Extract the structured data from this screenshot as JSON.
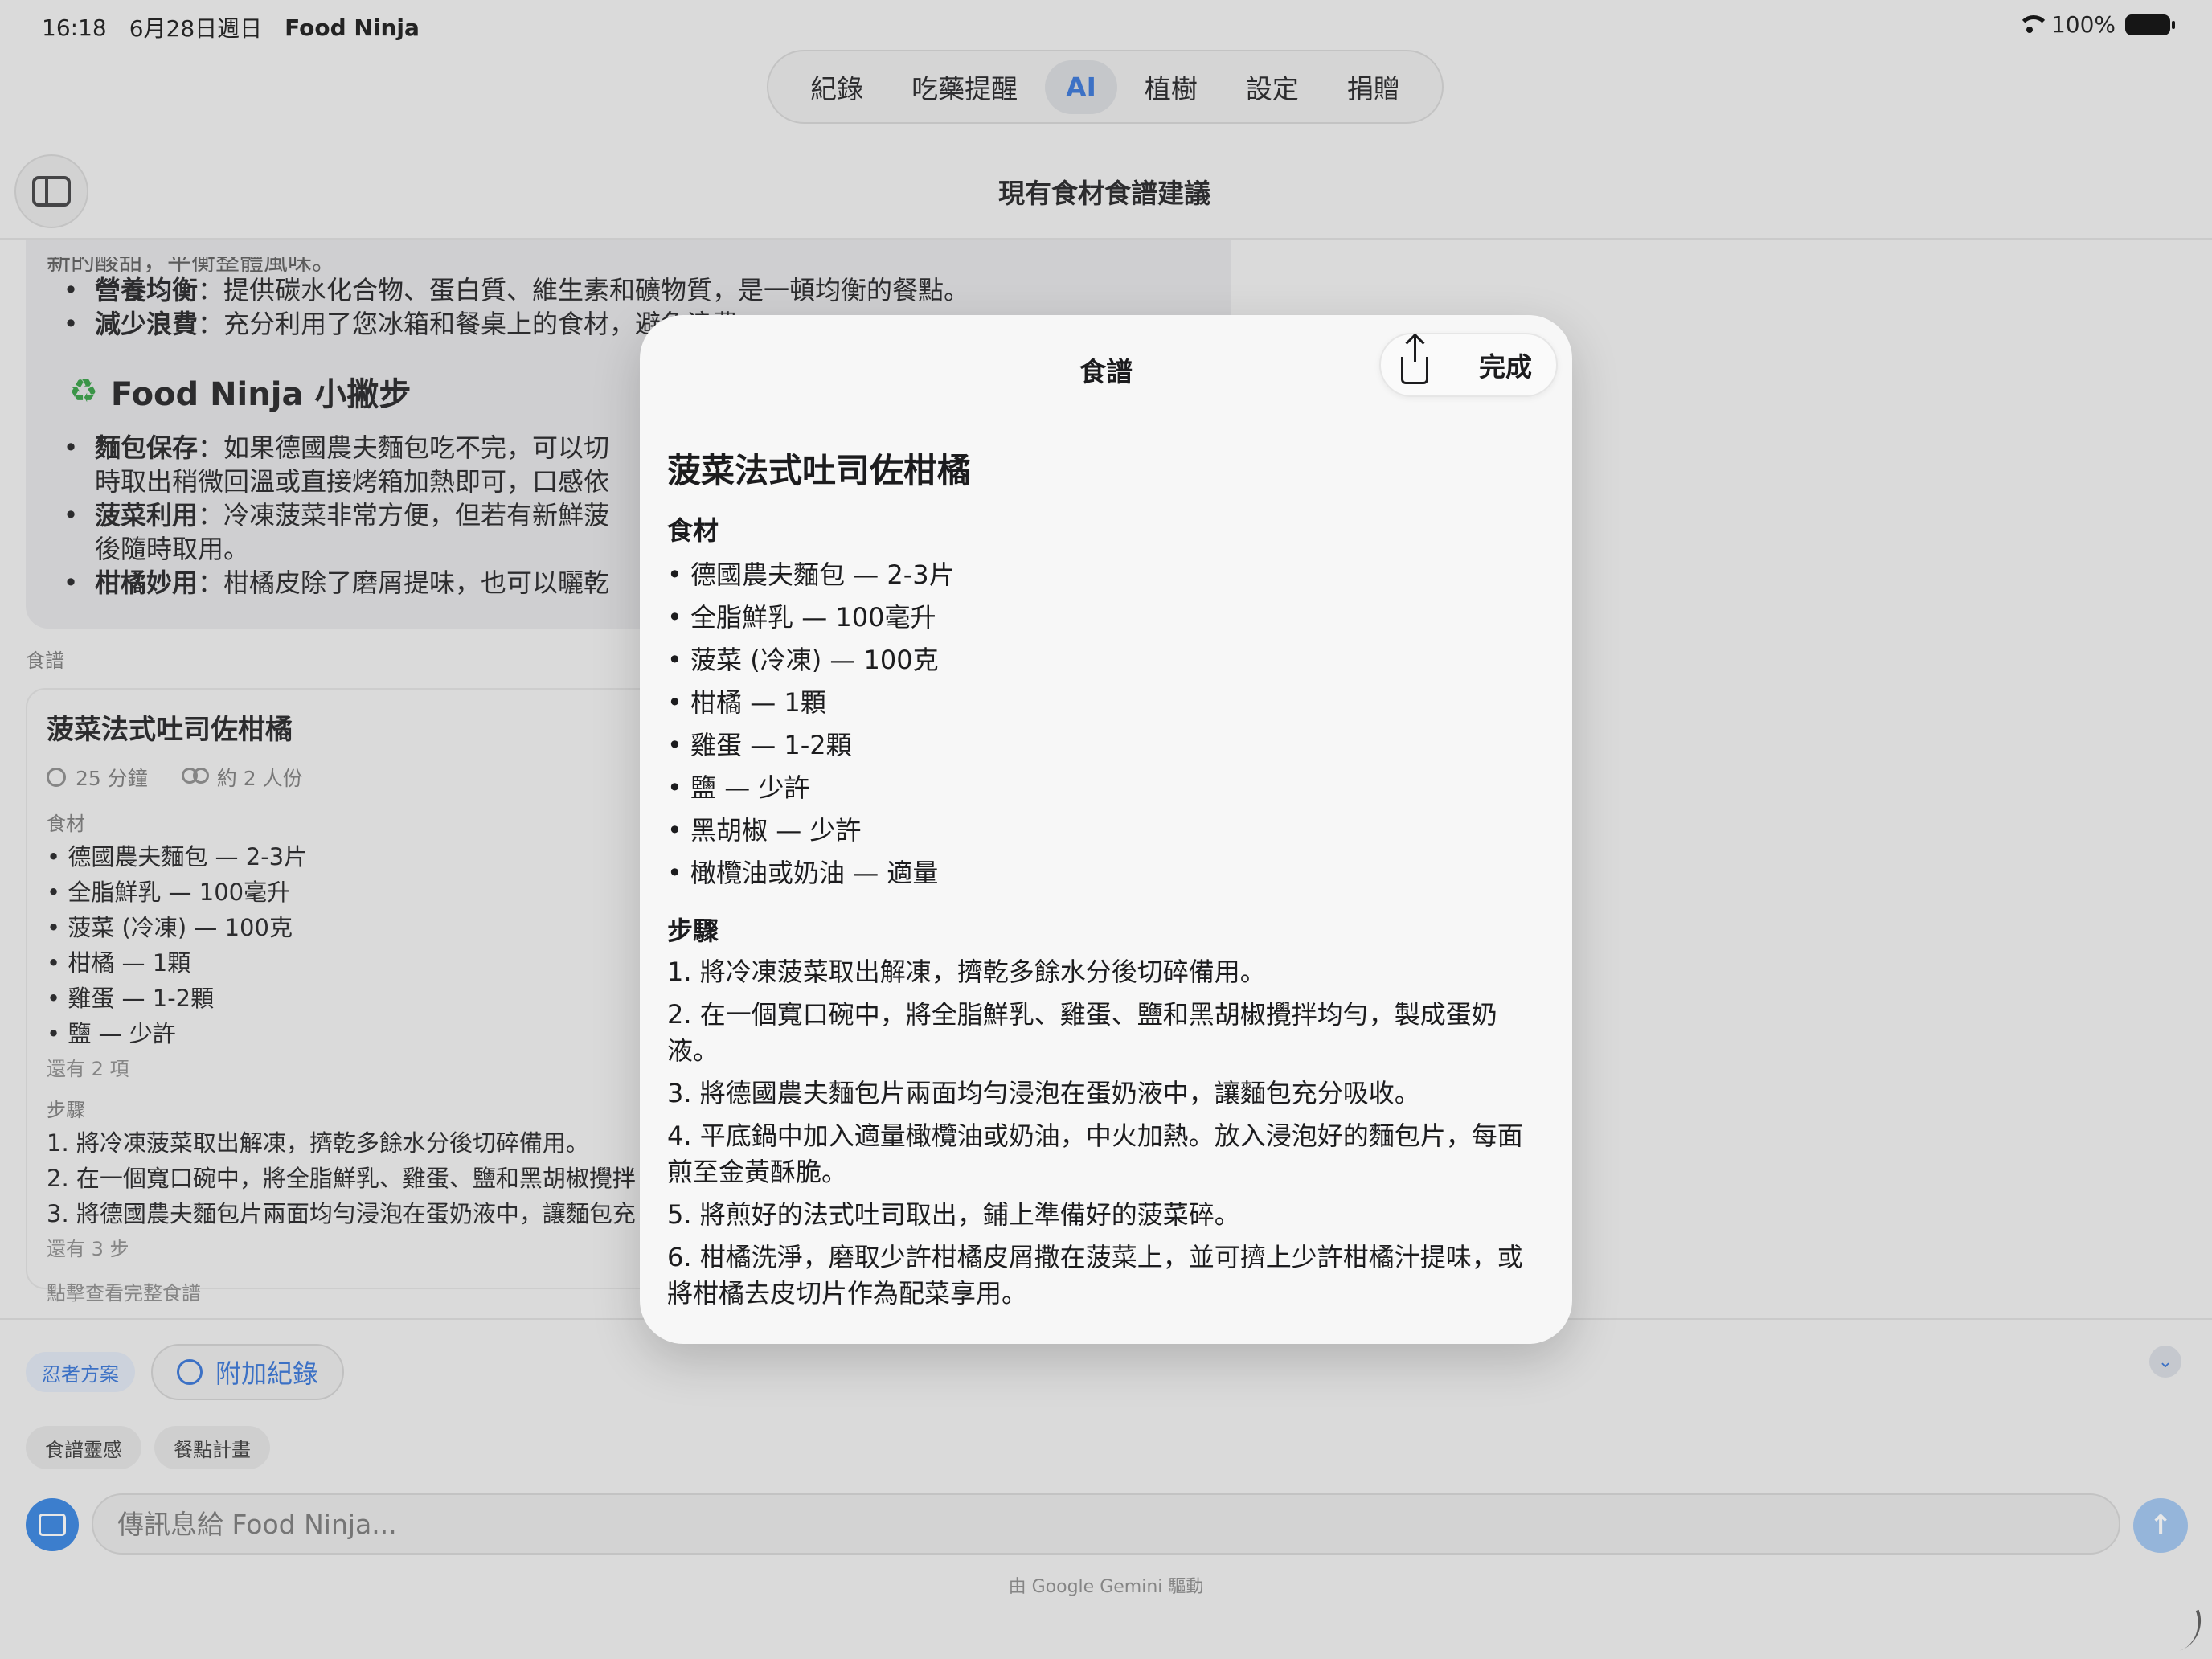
{
  "status_bar": {
    "time": "16:18",
    "date": "6月28日週日",
    "app_name": "Food Ninja",
    "battery": "100%"
  },
  "tabs": [
    {
      "label": "紀錄",
      "active": false
    },
    {
      "label": "吃藥提醒",
      "active": false
    },
    {
      "label": "AI",
      "active": true
    },
    {
      "label": "植樹",
      "active": false
    },
    {
      "label": "設定",
      "active": false
    },
    {
      "label": "捐贈",
      "active": false
    }
  ],
  "nav_title": "現有食材食譜建議",
  "chat": {
    "fragment": "新的酸甜，平衡整體風味。",
    "top_bullets": [
      {
        "bold": "營養均衡",
        "text": "：提供碳水化合物、蛋白質、維生素和礦物質，是一頓均衡的餐點。"
      },
      {
        "bold": "減少浪費",
        "text": "：充分利用了您冰箱和餐桌上的食材，避免浪費。"
      }
    ],
    "tips_title": "Food Ninja 小撇步",
    "tips": [
      {
        "bold": "麵包保存",
        "text": "：如果德國農夫麵包吃不完，可以切",
        "cont": "時取出稍微回溫或直接烤箱加熱即可，口感依"
      },
      {
        "bold": "菠菜利用",
        "text": "：冷凍菠菜非常方便，但若有新鮮菠",
        "cont": "後隨時取用。"
      },
      {
        "bold": "柑橘妙用",
        "text": "：柑橘皮除了磨屑提味，也可以曬乾"
      }
    ]
  },
  "recipe_label": "食譜",
  "recipe_card": {
    "title": "菠菜法式吐司佐柑橘",
    "time": "25 分鐘",
    "servings": "約 2 人份",
    "ingredients_label": "食材",
    "ingredients": [
      "• 德國農夫麵包 — 2-3片",
      "• 全脂鮮乳 — 100毫升",
      "• 菠菜 (冷凍) — 100克",
      "• 柑橘 — 1顆",
      "• 雞蛋 — 1-2顆",
      "• 鹽 — 少許"
    ],
    "more_ingredients": "還有 2 項",
    "steps_label": "步驟",
    "steps": [
      "1. 將冷凍菠菜取出解凍，擠乾多餘水分後切碎備用。",
      "2. 在一個寬口碗中，將全脂鮮乳、雞蛋、鹽和黑胡椒攪拌",
      "3. 將德國農夫麵包片兩面均勻浸泡在蛋奶液中，讓麵包充"
    ],
    "more_steps": "還有 3 步",
    "hint": "點擊查看完整食譜"
  },
  "composer": {
    "ninja_plan": "忍者方案",
    "attach_label": "附加紀錄",
    "suggestions": [
      "食譜靈感",
      "餐點計畫"
    ],
    "placeholder": "傳訊息給 Food Ninja...",
    "powered_by": "由 Google Gemini 驅動"
  },
  "sheet": {
    "title": "食譜",
    "done_label": "完成",
    "recipe_title": "菠菜法式吐司佐柑橘",
    "ingredients_label": "食材",
    "ingredients": [
      "• 德國農夫麵包 — 2-3片",
      "• 全脂鮮乳 — 100毫升",
      "• 菠菜 (冷凍) — 100克",
      "• 柑橘 — 1顆",
      "• 雞蛋 — 1-2顆",
      "• 鹽 — 少許",
      "• 黑胡椒 — 少許",
      "• 橄欖油或奶油 — 適量"
    ],
    "steps_label": "步驟",
    "steps": [
      "1. 將冷凍菠菜取出解凍，擠乾多餘水分後切碎備用。",
      "2. 在一個寬口碗中，將全脂鮮乳、雞蛋、鹽和黑胡椒攪拌均勻，製成蛋奶液。",
      "3. 將德國農夫麵包片兩面均勻浸泡在蛋奶液中，讓麵包充分吸收。",
      "4. 平底鍋中加入適量橄欖油或奶油，中火加熱。放入浸泡好的麵包片，每面煎至金黃酥脆。",
      "5. 將煎好的法式吐司取出，鋪上準備好的菠菜碎。",
      "6. 柑橘洗淨，磨取少許柑橘皮屑撒在菠菜上，並可擠上少許柑橘汁提味，或將柑橘去皮切片作為配菜享用。"
    ]
  },
  "colors": {
    "accent": "#2f6fd6",
    "sheet_bg": "#f7f7f7"
  }
}
